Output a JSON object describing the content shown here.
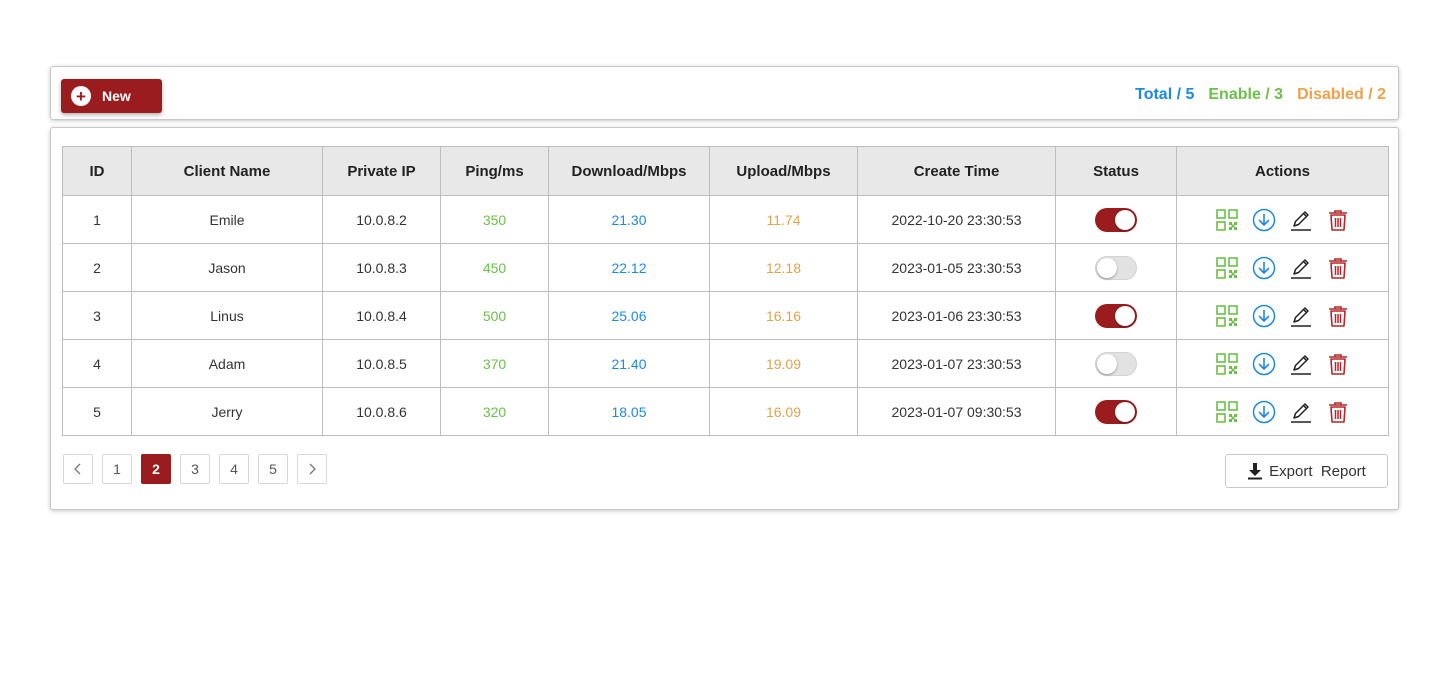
{
  "toolbar": {
    "new_label": "New",
    "total": "Total / 5",
    "enable": "Enable / 3",
    "disabled": "Disabled / 2"
  },
  "table": {
    "columns": [
      "ID",
      "Client Name",
      "Private IP",
      "Ping/ms",
      "Download/Mbps",
      "Upload/Mbps",
      "Create Time",
      "Status",
      "Actions"
    ],
    "rows": [
      {
        "id": "1",
        "name": "Emile",
        "ip": "10.0.8.2",
        "ping": "350",
        "download": "21.30",
        "upload": "11.74",
        "created": "2022-10-20 23:30:53",
        "status": "on"
      },
      {
        "id": "2",
        "name": "Jason",
        "ip": "10.0.8.3",
        "ping": "450",
        "download": "22.12",
        "upload": "12.18",
        "created": "2023-01-05 23:30:53",
        "status": "off"
      },
      {
        "id": "3",
        "name": "Linus",
        "ip": "10.0.8.4",
        "ping": "500",
        "download": "25.06",
        "upload": "16.16",
        "created": "2023-01-06 23:30:53",
        "status": "on"
      },
      {
        "id": "4",
        "name": "Adam",
        "ip": "10.0.8.5",
        "ping": "370",
        "download": "21.40",
        "upload": "19.09",
        "created": "2023-01-07 23:30:53",
        "status": "off"
      },
      {
        "id": "5",
        "name": "Jerry",
        "ip": "10.0.8.6",
        "ping": "320",
        "download": "18.05",
        "upload": "16.09",
        "created": "2023-01-07 09:30:53",
        "status": "on"
      }
    ]
  },
  "pagination": {
    "prev_icon": "chevron-left-icon",
    "next_icon": "chevron-right-icon",
    "pages": [
      "1",
      "2",
      "3",
      "4",
      "5"
    ],
    "current": "2"
  },
  "export": {
    "label": "Export  Report",
    "icon": "download-icon"
  },
  "colors": {
    "brand": "#9b1c1f",
    "total": "#1e88e5",
    "enable": "#6cc04a",
    "disabled": "#f0a04b",
    "qr_icon": "#6cc04a",
    "download_icon": "#1e88e5",
    "delete_icon": "#b3262a"
  }
}
